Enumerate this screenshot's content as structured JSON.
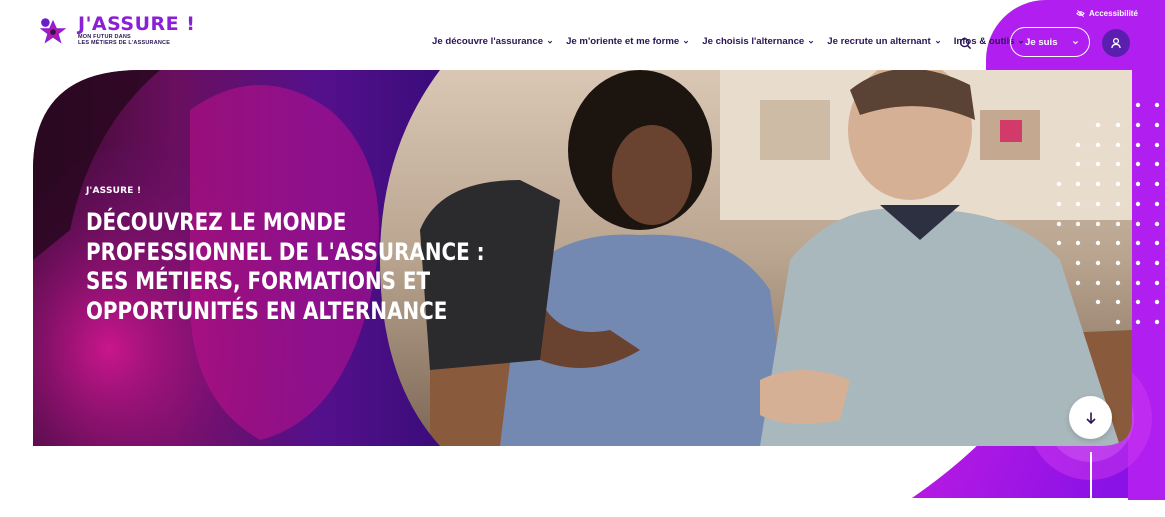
{
  "header": {
    "logo": {
      "title": "J'ASSURE !",
      "subtitle_line1": "MON FUTUR DANS",
      "subtitle_line2": "LES MÉTIERS DE L'ASSURANCE"
    },
    "nav": [
      {
        "label": "Je découvre l'assurance"
      },
      {
        "label": "Je m'oriente et me forme"
      },
      {
        "label": "Je choisis l'alternance"
      },
      {
        "label": "Je recrute un alternant"
      },
      {
        "label": "Infos & outils"
      }
    ],
    "accessibility_label": "Accessibilité",
    "je_suis_label": "Je suis"
  },
  "hero": {
    "kicker": "J'ASSURE !",
    "headline_lines": [
      "Découvrez le monde",
      "professionnel de l'assurance :",
      "ses métiers, formations et",
      "opportunités en alternance"
    ]
  },
  "colors": {
    "brand_purple": "#b01ef0",
    "deep_violet": "#5b1fb0",
    "navy_text": "#2a1556",
    "magenta": "#c4159a"
  },
  "icons": {
    "search": "search-icon",
    "accessibility": "accessibility-icon",
    "user": "user-icon",
    "scroll": "arrow-down-icon"
  }
}
